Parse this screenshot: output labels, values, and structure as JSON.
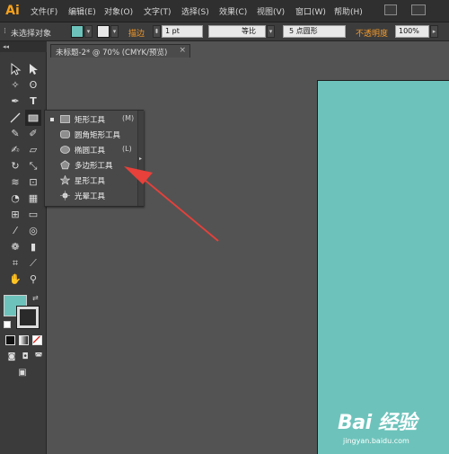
{
  "app": {
    "logo": "Ai"
  },
  "menubar": {
    "items": [
      "文件(F)",
      "编辑(E)",
      "对象(O)",
      "文字(T)",
      "选择(S)",
      "效果(C)",
      "视图(V)",
      "窗口(W)",
      "帮助(H)"
    ]
  },
  "controlbar": {
    "selection_status": "未选择对象",
    "stroke_label": "描边",
    "stroke_weight": "1 pt",
    "stroke_style": "等比",
    "brush": "5 点圆形",
    "opacity_label": "不透明度",
    "opacity_value": "100%",
    "fill_color": "#6dc3bb"
  },
  "toolbox": {
    "header": "◂◂"
  },
  "document": {
    "tab_label": "未标题-2* @ 70% (CMYK/预览)",
    "close_glyph": "×",
    "artboard_color": "#6dc3bb"
  },
  "flyout": {
    "items": [
      {
        "label": "矩形工具",
        "shortcut": "(M)",
        "icon": "rectangle-icon",
        "selected": true
      },
      {
        "label": "圆角矩形工具",
        "shortcut": "",
        "icon": "rounded-rectangle-icon",
        "selected": false
      },
      {
        "label": "椭圆工具",
        "shortcut": "(L)",
        "icon": "ellipse-icon",
        "selected": false
      },
      {
        "label": "多边形工具",
        "shortcut": "",
        "icon": "polygon-icon",
        "selected": false
      },
      {
        "label": "星形工具",
        "shortcut": "",
        "icon": "star-icon",
        "selected": false
      },
      {
        "label": "光晕工具",
        "shortcut": "",
        "icon": "flare-icon",
        "selected": false
      }
    ]
  },
  "watermark": {
    "logo": "Bai 经验",
    "url": "jingyan.baidu.com"
  },
  "colors": {
    "annotation_arrow": "#e8403a",
    "brand": "#f7a11a"
  }
}
